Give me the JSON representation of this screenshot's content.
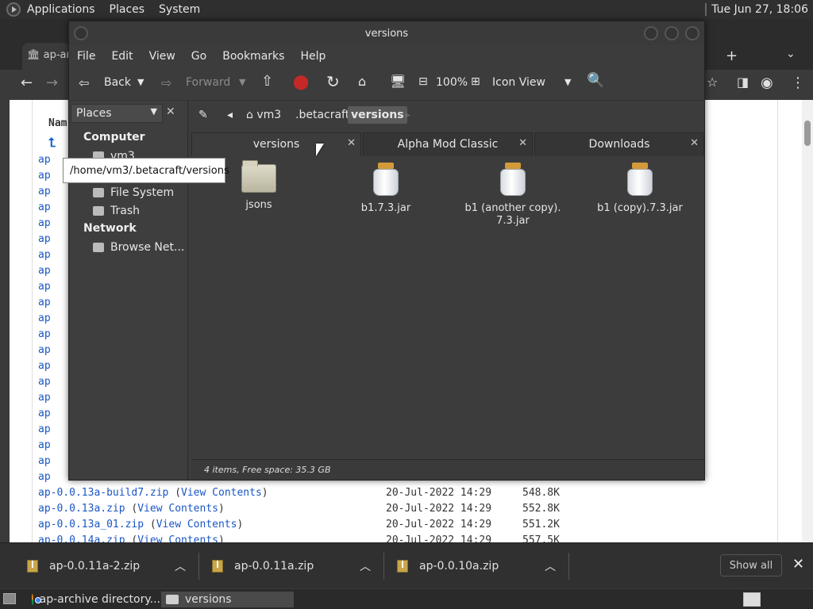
{
  "top_panel": {
    "menus": [
      "Applications",
      "Places",
      "System"
    ],
    "clock": "Tue Jun 27, 18:06"
  },
  "browser": {
    "tab_title": "ap-ar",
    "column_header": "Nam",
    "list_prefix": "ap",
    "rows": [
      {
        "name": "ap-0.0.13a-build7.zip",
        "view": "View Contents",
        "date": "20-Jul-2022 14:29",
        "size": "548.8K"
      },
      {
        "name": "ap-0.0.13a.zip",
        "view": "View Contents",
        "date": "20-Jul-2022 14:29",
        "size": "552.8K"
      },
      {
        "name": "ap-0.0.13a_01.zip",
        "view": "View Contents",
        "date": "20-Jul-2022 14:29",
        "size": "551.2K"
      },
      {
        "name": "ap-0.0.14a.zip",
        "view": "View Contents",
        "date": "20-Jul-2022 14:29",
        "size": "557.5K"
      }
    ]
  },
  "downloads": {
    "items": [
      "ap-0.0.11a-2.zip",
      "ap-0.0.11a.zip",
      "ap-0.0.10a.zip"
    ],
    "show_all": "Show all"
  },
  "taskbar": {
    "items": [
      "ap-archive directory...",
      "versions"
    ]
  },
  "file_manager": {
    "title": "versions",
    "menus": [
      "File",
      "Edit",
      "View",
      "Go",
      "Bookmarks",
      "Help"
    ],
    "toolbar": {
      "back": "Back",
      "forward": "Forward",
      "zoom": "100%",
      "view_mode": "Icon View"
    },
    "sidebar": {
      "selector": "Places",
      "computer_heading": "Computer",
      "computer_items": [
        "vm3",
        "File System",
        "Trash"
      ],
      "network_heading": "Network",
      "network_items": [
        "Browse Net..."
      ]
    },
    "tooltip": "/home/vm3/.betacraft/versions",
    "path": [
      "vm3",
      ".betacraft",
      "versions"
    ],
    "tabs": [
      "versions",
      "Alpha Mod Classic",
      "Downloads"
    ],
    "items": [
      {
        "name": "jsons",
        "type": "folder"
      },
      {
        "name": "b1.7.3.jar",
        "type": "jar"
      },
      {
        "name": "b1 (another copy).7.3.jar",
        "type": "jar"
      },
      {
        "name": "b1 (copy).7.3.jar",
        "type": "jar"
      }
    ],
    "status": "4 items, Free space: 35.3 GB"
  },
  "colors": {
    "link_blue": "#1a56c6",
    "panel_dark": "#2f2f2f",
    "fm_bg": "#3c3c3c",
    "jar_lid": "#d39a3b"
  }
}
